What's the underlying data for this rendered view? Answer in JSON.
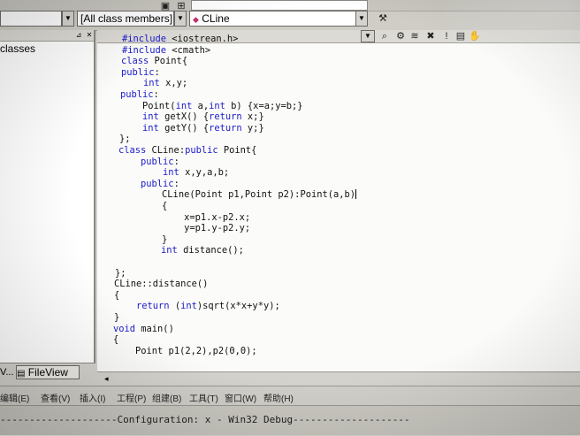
{
  "toolbar": {
    "scope_combo": "",
    "members_combo": "[All class members]",
    "function_combo": "CLine",
    "find_combo": ""
  },
  "left_pane": {
    "classes_label": "classes",
    "tab_prev_label": "V...",
    "tab_fileview_label": "FileView"
  },
  "code_lines": [
    "#include <iostrean.h>",
    "#include <cmath>",
    "class Point{",
    "public:",
    "    int x,y;",
    "public:",
    "    Point(int a,int b) {x=a;y=b;}",
    "    int getX() {return x;}",
    "    int getY() {return y;}",
    "};",
    "class CLine:public Point{",
    "    public:",
    "        int x,y,a,b;",
    "    public:",
    "        CLine(Point p1,Point p2):Point(a,b)",
    "        {",
    "            x=p1.x-p2.x;",
    "            y=p1.y-p2.y;",
    "        }",
    "        int distance();",
    "",
    "};",
    "CLine::distance()",
    "{",
    "    return (int)sqrt(x*x+y*y);",
    "}",
    "void main()",
    "{",
    "    Point p1(2,2),p2(0,0);"
  ],
  "menu": {
    "items": [
      "编辑(E)",
      "查看(V)",
      "插入(I)",
      "工程(P)",
      "组建(B)",
      "工具(T)",
      "窗口(W)",
      "帮助(H)"
    ]
  },
  "status": {
    "configuration": "--------------------Configuration: x - Win32 Debug--------------------"
  },
  "colors": {
    "keyword": "#1a1acc",
    "text": "#111111",
    "editor_bg": "#fbfbf9",
    "chrome": "#d4d2cc"
  }
}
